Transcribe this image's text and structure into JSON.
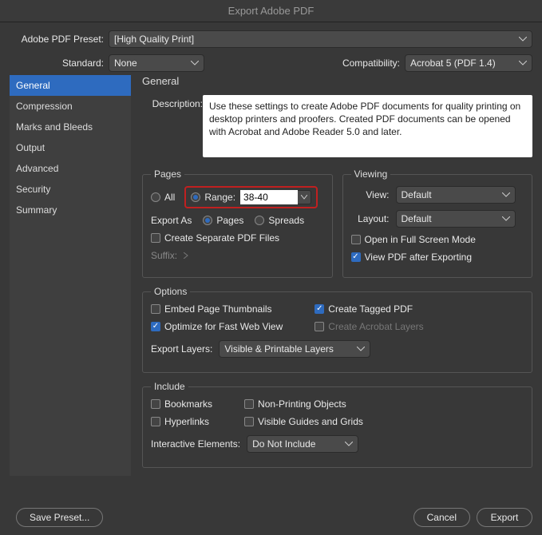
{
  "titlebar": "Export Adobe PDF",
  "preset": {
    "label": "Adobe PDF Preset:",
    "value": "[High Quality Print]"
  },
  "standard": {
    "label": "Standard:",
    "value": "None"
  },
  "compatibility": {
    "label": "Compatibility:",
    "value": "Acrobat 5 (PDF 1.4)"
  },
  "sidebar": {
    "items": [
      {
        "label": "General"
      },
      {
        "label": "Compression"
      },
      {
        "label": "Marks and Bleeds"
      },
      {
        "label": "Output"
      },
      {
        "label": "Advanced"
      },
      {
        "label": "Security"
      },
      {
        "label": "Summary"
      }
    ]
  },
  "general": {
    "heading": "General",
    "description_label": "Description:",
    "description": "Use these settings to create Adobe PDF documents for quality printing on desktop printers and proofers.  Created PDF documents can be opened with Acrobat and Adobe Reader 5.0 and later."
  },
  "pages": {
    "legend": "Pages",
    "all": "All",
    "range_label": "Range:",
    "range_value": "38-40",
    "export_as": "Export As",
    "pages_opt": "Pages",
    "spreads_opt": "Spreads",
    "separate": "Create Separate PDF Files",
    "suffix": "Suffix:"
  },
  "viewing": {
    "legend": "Viewing",
    "view_label": "View:",
    "view_value": "Default",
    "layout_label": "Layout:",
    "layout_value": "Default",
    "fullscreen": "Open in Full Screen Mode",
    "view_after": "View PDF after Exporting"
  },
  "options": {
    "legend": "Options",
    "thumbnails": "Embed Page Thumbnails",
    "tagged": "Create Tagged PDF",
    "optimize": "Optimize for Fast Web View",
    "acrobat_layers": "Create Acrobat Layers",
    "export_layers_label": "Export Layers:",
    "export_layers_value": "Visible & Printable Layers"
  },
  "include": {
    "legend": "Include",
    "bookmarks": "Bookmarks",
    "hyperlinks": "Hyperlinks",
    "nonprinting": "Non-Printing Objects",
    "guides": "Visible Guides and Grids",
    "interactive_label": "Interactive Elements:",
    "interactive_value": "Do Not Include"
  },
  "footer": {
    "save_preset": "Save Preset...",
    "cancel": "Cancel",
    "export": "Export"
  }
}
